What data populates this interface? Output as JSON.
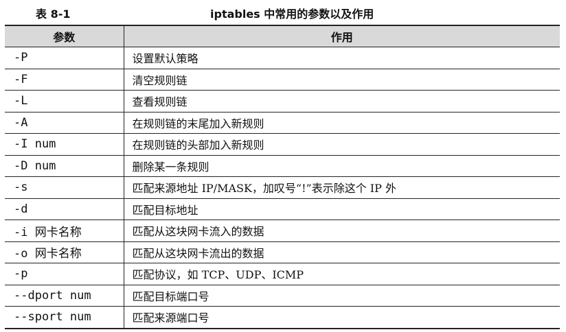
{
  "caption": {
    "number": "表 8-1",
    "title": "iptables 中常用的参数以及作用"
  },
  "table": {
    "headers": [
      "参数",
      "作用"
    ],
    "rows": [
      {
        "param": "-P",
        "desc": "设置默认策略"
      },
      {
        "param": "-F",
        "desc": "清空规则链"
      },
      {
        "param": "-L",
        "desc": "查看规则链"
      },
      {
        "param": "-A",
        "desc": "在规则链的末尾加入新规则"
      },
      {
        "param": "-I num",
        "desc": "在规则链的头部加入新规则"
      },
      {
        "param": "-D num",
        "desc": "删除某一条规则"
      },
      {
        "param": "-s",
        "desc": "匹配来源地址 IP/MASK，加叹号“!”表示除这个 IP 外"
      },
      {
        "param": "-d",
        "desc": "匹配目标地址"
      },
      {
        "param": "-i 网卡名称",
        "desc": "匹配从这块网卡流入的数据"
      },
      {
        "param": "-o 网卡名称",
        "desc": "匹配从这块网卡流出的数据"
      },
      {
        "param": "-p",
        "desc": "匹配协议，如 TCP、UDP、ICMP"
      },
      {
        "param": "--dport num",
        "desc": "匹配目标端口号"
      },
      {
        "param": "--sport num",
        "desc": "匹配来源端口号"
      }
    ]
  }
}
